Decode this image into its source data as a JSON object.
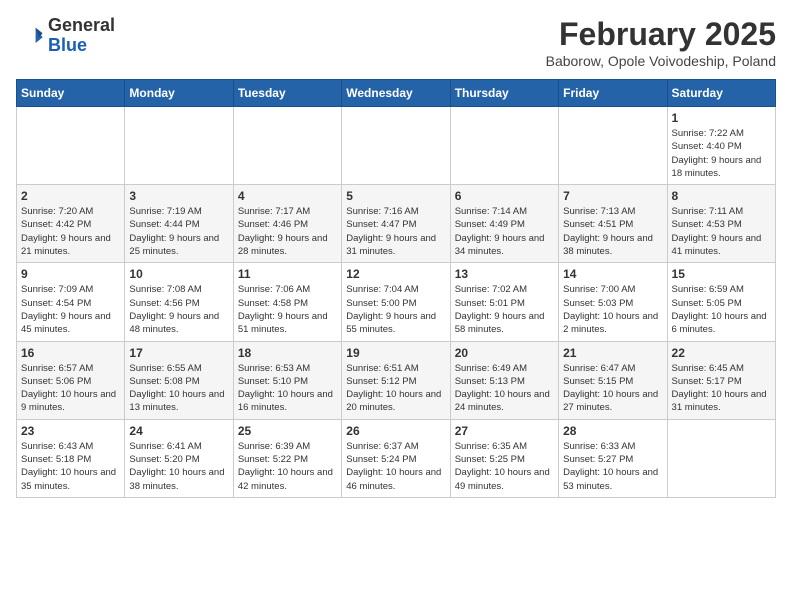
{
  "logo": {
    "general": "General",
    "blue": "Blue"
  },
  "title": {
    "month_year": "February 2025",
    "location": "Baborow, Opole Voivodeship, Poland"
  },
  "headers": [
    "Sunday",
    "Monday",
    "Tuesday",
    "Wednesday",
    "Thursday",
    "Friday",
    "Saturday"
  ],
  "weeks": [
    [
      {
        "day": "",
        "info": ""
      },
      {
        "day": "",
        "info": ""
      },
      {
        "day": "",
        "info": ""
      },
      {
        "day": "",
        "info": ""
      },
      {
        "day": "",
        "info": ""
      },
      {
        "day": "",
        "info": ""
      },
      {
        "day": "1",
        "info": "Sunrise: 7:22 AM\nSunset: 4:40 PM\nDaylight: 9 hours and 18 minutes."
      }
    ],
    [
      {
        "day": "2",
        "info": "Sunrise: 7:20 AM\nSunset: 4:42 PM\nDaylight: 9 hours and 21 minutes."
      },
      {
        "day": "3",
        "info": "Sunrise: 7:19 AM\nSunset: 4:44 PM\nDaylight: 9 hours and 25 minutes."
      },
      {
        "day": "4",
        "info": "Sunrise: 7:17 AM\nSunset: 4:46 PM\nDaylight: 9 hours and 28 minutes."
      },
      {
        "day": "5",
        "info": "Sunrise: 7:16 AM\nSunset: 4:47 PM\nDaylight: 9 hours and 31 minutes."
      },
      {
        "day": "6",
        "info": "Sunrise: 7:14 AM\nSunset: 4:49 PM\nDaylight: 9 hours and 34 minutes."
      },
      {
        "day": "7",
        "info": "Sunrise: 7:13 AM\nSunset: 4:51 PM\nDaylight: 9 hours and 38 minutes."
      },
      {
        "day": "8",
        "info": "Sunrise: 7:11 AM\nSunset: 4:53 PM\nDaylight: 9 hours and 41 minutes."
      }
    ],
    [
      {
        "day": "9",
        "info": "Sunrise: 7:09 AM\nSunset: 4:54 PM\nDaylight: 9 hours and 45 minutes."
      },
      {
        "day": "10",
        "info": "Sunrise: 7:08 AM\nSunset: 4:56 PM\nDaylight: 9 hours and 48 minutes."
      },
      {
        "day": "11",
        "info": "Sunrise: 7:06 AM\nSunset: 4:58 PM\nDaylight: 9 hours and 51 minutes."
      },
      {
        "day": "12",
        "info": "Sunrise: 7:04 AM\nSunset: 5:00 PM\nDaylight: 9 hours and 55 minutes."
      },
      {
        "day": "13",
        "info": "Sunrise: 7:02 AM\nSunset: 5:01 PM\nDaylight: 9 hours and 58 minutes."
      },
      {
        "day": "14",
        "info": "Sunrise: 7:00 AM\nSunset: 5:03 PM\nDaylight: 10 hours and 2 minutes."
      },
      {
        "day": "15",
        "info": "Sunrise: 6:59 AM\nSunset: 5:05 PM\nDaylight: 10 hours and 6 minutes."
      }
    ],
    [
      {
        "day": "16",
        "info": "Sunrise: 6:57 AM\nSunset: 5:06 PM\nDaylight: 10 hours and 9 minutes."
      },
      {
        "day": "17",
        "info": "Sunrise: 6:55 AM\nSunset: 5:08 PM\nDaylight: 10 hours and 13 minutes."
      },
      {
        "day": "18",
        "info": "Sunrise: 6:53 AM\nSunset: 5:10 PM\nDaylight: 10 hours and 16 minutes."
      },
      {
        "day": "19",
        "info": "Sunrise: 6:51 AM\nSunset: 5:12 PM\nDaylight: 10 hours and 20 minutes."
      },
      {
        "day": "20",
        "info": "Sunrise: 6:49 AM\nSunset: 5:13 PM\nDaylight: 10 hours and 24 minutes."
      },
      {
        "day": "21",
        "info": "Sunrise: 6:47 AM\nSunset: 5:15 PM\nDaylight: 10 hours and 27 minutes."
      },
      {
        "day": "22",
        "info": "Sunrise: 6:45 AM\nSunset: 5:17 PM\nDaylight: 10 hours and 31 minutes."
      }
    ],
    [
      {
        "day": "23",
        "info": "Sunrise: 6:43 AM\nSunset: 5:18 PM\nDaylight: 10 hours and 35 minutes."
      },
      {
        "day": "24",
        "info": "Sunrise: 6:41 AM\nSunset: 5:20 PM\nDaylight: 10 hours and 38 minutes."
      },
      {
        "day": "25",
        "info": "Sunrise: 6:39 AM\nSunset: 5:22 PM\nDaylight: 10 hours and 42 minutes."
      },
      {
        "day": "26",
        "info": "Sunrise: 6:37 AM\nSunset: 5:24 PM\nDaylight: 10 hours and 46 minutes."
      },
      {
        "day": "27",
        "info": "Sunrise: 6:35 AM\nSunset: 5:25 PM\nDaylight: 10 hours and 49 minutes."
      },
      {
        "day": "28",
        "info": "Sunrise: 6:33 AM\nSunset: 5:27 PM\nDaylight: 10 hours and 53 minutes."
      },
      {
        "day": "",
        "info": ""
      }
    ]
  ]
}
